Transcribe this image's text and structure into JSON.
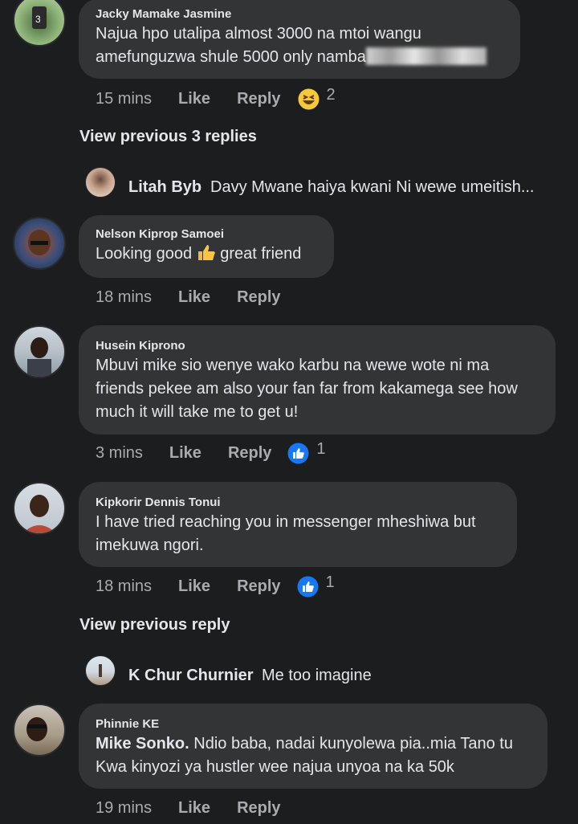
{
  "comments": [
    {
      "author": "Jacky Mamake Jasmine",
      "text_l1": "Najua hpo utalipa almost 3000 na mtoi wangu",
      "text_l2": "amefunguzwa shule 5000 only namba",
      "time": "15 mins",
      "like": "Like",
      "reply": "Reply",
      "reaction_count": "2",
      "reaction": "haha-emoji"
    },
    {
      "author": "Nelson Kiprop Samoei",
      "text_a": "Looking good",
      "text_b": "great friend",
      "time": "18 mins",
      "like": "Like",
      "reply": "Reply"
    },
    {
      "author": "Husein Kiprono",
      "text_l1": "Mbuvi mike sio wenye wako karbu na wewe wote ni ma",
      "text_l2": "friends pekee am also your fan far from kakamega see how",
      "text_l3": "much it will take me to get u!",
      "time": "3 mins",
      "like": "Like",
      "reply": "Reply",
      "reaction_count": "1",
      "reaction": "like"
    },
    {
      "author": "Kipkorir Dennis Tonui",
      "text_l1": "I have tried reaching you in  messenger mheshiwa but",
      "text_l2": "imekuwa ngori.",
      "time": "18 mins",
      "like": "Like",
      "reply": "Reply",
      "reaction_count": "1",
      "reaction": "like"
    },
    {
      "author": "Phinnie KE",
      "mention": "Mike Sonko.",
      "text_l1": " Ndio baba, nadai kunyolewa pia..mia Tano tu",
      "text_l2": "Kwa kinyozi ya hustler wee najua unyoa na ka 50k",
      "time": "19 mins",
      "like": "Like",
      "reply": "Reply"
    }
  ],
  "view_previous": [
    "View previous 3 replies",
    "View previous reply"
  ],
  "collapsed_replies": [
    {
      "name": "Litah Byb",
      "snippet": "Davy Mwane haiya kwani Ni wewe umeitish..."
    },
    {
      "name": "K Chur Churnier",
      "snippet": "Me too imagine"
    }
  ],
  "colors": {
    "background": "#1c1d1f",
    "bubble": "#333436",
    "meta": "#a8abaf",
    "like_blue": "#1877f2"
  }
}
